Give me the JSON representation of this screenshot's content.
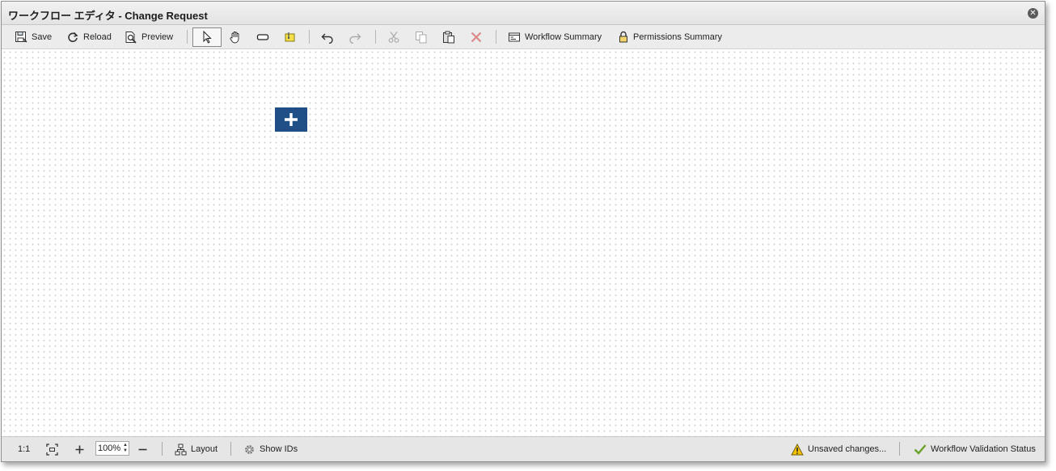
{
  "window": {
    "title": "ワークフロー エディタ - Change Request"
  },
  "toolbar": {
    "save_label": "Save",
    "reload_label": "Reload",
    "preview_label": "Preview",
    "workflow_summary_label": "Workflow Summary",
    "permissions_summary_label": "Permissions Summary"
  },
  "statusbar": {
    "actual_size_label": "1:1",
    "zoom_value": "100%",
    "layout_label": "Layout",
    "show_ids_label": "Show IDs",
    "unsaved_label": "Unsaved changes...",
    "validation_label": "Workflow Validation Status"
  },
  "colors": {
    "add_node": "#1f4f86",
    "warning": "#f3c200",
    "validation_check": "#6aa12b",
    "delete": "#d23a3a"
  },
  "icons": {
    "save": "floppy-disk-icon",
    "reload": "reload-icon",
    "preview": "preview-icon",
    "select": "pointer-icon",
    "pan": "hand-icon",
    "step": "step-icon",
    "note": "note-icon",
    "undo": "undo-icon",
    "redo": "redo-icon",
    "cut": "cut-icon",
    "copy": "copy-icon",
    "paste": "paste-icon",
    "delete": "delete-icon",
    "workflow_summary": "summary-icon",
    "permissions_summary": "lock-icon",
    "fit": "fit-screen-icon",
    "zoom_in": "zoom-in-icon",
    "zoom_out": "zoom-out-icon",
    "layout": "layout-icon",
    "show_ids": "gear-icon",
    "unsaved": "warning-icon",
    "validation": "checkmark-icon",
    "add_node": "plus-icon",
    "close": "close-icon"
  }
}
